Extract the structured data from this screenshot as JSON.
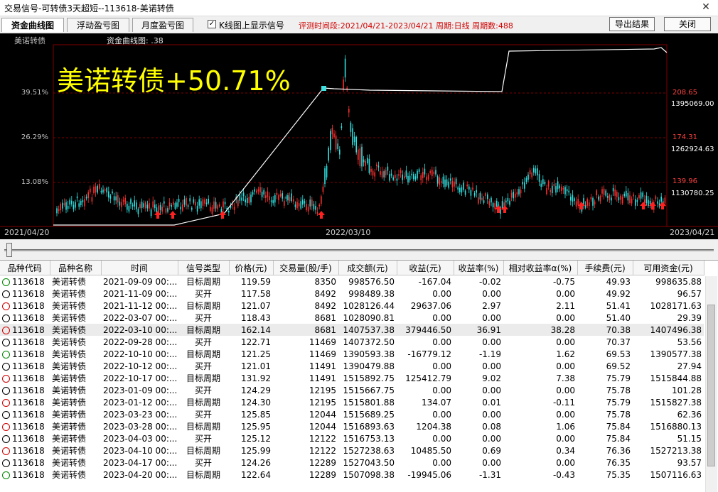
{
  "window": {
    "title": "交易信号-可转债3天超短--113618-美诺转债"
  },
  "toolbar": {
    "tabs": [
      {
        "label": "资金曲线图"
      },
      {
        "label": "浮动盈亏图"
      },
      {
        "label": "月度盈亏图"
      }
    ],
    "checkbox_label": "K线图上显示信号",
    "checkbox_checked": true,
    "period_text": "评测时间段:2021/04/21-2023/04/21  周期:日线  周期数:488",
    "export_label": "导出结果",
    "close_label": "关闭"
  },
  "chart": {
    "name": "美诺转债",
    "sub_label": "资金曲线图: ",
    "sub_value": ".38",
    "big_label": "美诺转债+50.71%",
    "left_axis": [
      "39.51%",
      "26.29%",
      "13.08%"
    ],
    "right_axis_price": [
      "208.65",
      "174.31",
      "139.96"
    ],
    "right_axis_capital": [
      "1395069.00",
      "1262924.63",
      "1130780.25"
    ],
    "dates": {
      "start": "2021/04/20",
      "mid": "2022/03/10",
      "end": "2023/04/21"
    },
    "colors": {
      "up": "#ff3030",
      "down": "#30e0e0",
      "equity": "#ffffff",
      "signal": "#ff2020",
      "grid": "#800000"
    }
  },
  "table": {
    "columns": [
      "品种代码",
      "品种名称",
      "时间",
      "信号类型",
      "价格(元)",
      "交易量(股/手)",
      "成交额(元)",
      "收益(元)",
      "收益率(%)",
      "相对收益率α(%)",
      "手续费(元)",
      "可用资金(元)"
    ],
    "rows": [
      {
        "icon": "green",
        "code": "113618",
        "name": "美诺转债",
        "time": "2021-09-09 00:...",
        "type": "目标周期",
        "price": "119.59",
        "volume": "8350",
        "amount": "998576.50",
        "profit": "-167.04",
        "rate": "-0.02",
        "alpha": "-0.75",
        "fee": "49.93",
        "cash": "998635.88"
      },
      {
        "icon": "black",
        "code": "113618",
        "name": "美诺转债",
        "time": "2021-11-09 00:...",
        "type": "买开",
        "price": "117.58",
        "volume": "8492",
        "amount": "998489.38",
        "profit": "0.00",
        "rate": "0.00",
        "alpha": "0.00",
        "fee": "49.92",
        "cash": "96.57"
      },
      {
        "icon": "red",
        "code": "113618",
        "name": "美诺转债",
        "time": "2021-11-12 00:...",
        "type": "目标周期",
        "price": "121.07",
        "volume": "8492",
        "amount": "1028126.44",
        "profit": "29637.06",
        "rate": "2.97",
        "alpha": "2.11",
        "fee": "51.41",
        "cash": "1028171.63"
      },
      {
        "icon": "black",
        "code": "113618",
        "name": "美诺转债",
        "time": "2022-03-07 00:...",
        "type": "买开",
        "price": "118.43",
        "volume": "8681",
        "amount": "1028090.81",
        "profit": "0.00",
        "rate": "0.00",
        "alpha": "0.00",
        "fee": "51.40",
        "cash": "29.39"
      },
      {
        "icon": "red",
        "code": "113618",
        "name": "美诺转债",
        "time": "2022-03-10 00:...",
        "type": "目标周期",
        "price": "162.14",
        "volume": "8681",
        "amount": "1407537.38",
        "profit": "379446.50",
        "rate": "36.91",
        "alpha": "38.28",
        "fee": "70.38",
        "cash": "1407496.38",
        "selected": true
      },
      {
        "icon": "black",
        "code": "113618",
        "name": "美诺转债",
        "time": "2022-09-28 00:...",
        "type": "买开",
        "price": "122.71",
        "volume": "11469",
        "amount": "1407372.50",
        "profit": "0.00",
        "rate": "0.00",
        "alpha": "0.00",
        "fee": "70.37",
        "cash": "53.56"
      },
      {
        "icon": "green",
        "code": "113618",
        "name": "美诺转债",
        "time": "2022-10-10 00:...",
        "type": "目标周期",
        "price": "121.25",
        "volume": "11469",
        "amount": "1390593.38",
        "profit": "-16779.12",
        "rate": "-1.19",
        "alpha": "1.62",
        "fee": "69.53",
        "cash": "1390577.38"
      },
      {
        "icon": "black",
        "code": "113618",
        "name": "美诺转债",
        "time": "2022-10-12 00:...",
        "type": "买开",
        "price": "121.01",
        "volume": "11491",
        "amount": "1390479.88",
        "profit": "0.00",
        "rate": "0.00",
        "alpha": "0.00",
        "fee": "69.52",
        "cash": "27.94"
      },
      {
        "icon": "red",
        "code": "113618",
        "name": "美诺转债",
        "time": "2022-10-17 00:...",
        "type": "目标周期",
        "price": "131.92",
        "volume": "11491",
        "amount": "1515892.75",
        "profit": "125412.79",
        "rate": "9.02",
        "alpha": "7.38",
        "fee": "75.79",
        "cash": "1515844.88"
      },
      {
        "icon": "black",
        "code": "113618",
        "name": "美诺转债",
        "time": "2023-01-09 00:...",
        "type": "买开",
        "price": "124.29",
        "volume": "12195",
        "amount": "1515667.75",
        "profit": "0.00",
        "rate": "0.00",
        "alpha": "0.00",
        "fee": "75.78",
        "cash": "101.28"
      },
      {
        "icon": "red",
        "code": "113618",
        "name": "美诺转债",
        "time": "2023-01-12 00:...",
        "type": "目标周期",
        "price": "124.30",
        "volume": "12195",
        "amount": "1515801.88",
        "profit": "134.07",
        "rate": "0.01",
        "alpha": "-0.11",
        "fee": "75.79",
        "cash": "1515827.38"
      },
      {
        "icon": "black",
        "code": "113618",
        "name": "美诺转债",
        "time": "2023-03-23 00:...",
        "type": "买开",
        "price": "125.85",
        "volume": "12044",
        "amount": "1515689.25",
        "profit": "0.00",
        "rate": "0.00",
        "alpha": "0.00",
        "fee": "75.78",
        "cash": "62.36"
      },
      {
        "icon": "red",
        "code": "113618",
        "name": "美诺转债",
        "time": "2023-03-28 00:...",
        "type": "目标周期",
        "price": "125.95",
        "volume": "12044",
        "amount": "1516893.63",
        "profit": "1204.38",
        "rate": "0.08",
        "alpha": "1.06",
        "fee": "75.84",
        "cash": "1516880.13"
      },
      {
        "icon": "black",
        "code": "113618",
        "name": "美诺转债",
        "time": "2023-04-03 00:...",
        "type": "买开",
        "price": "125.12",
        "volume": "12122",
        "amount": "1516753.13",
        "profit": "0.00",
        "rate": "0.00",
        "alpha": "0.00",
        "fee": "75.84",
        "cash": "51.15"
      },
      {
        "icon": "red",
        "code": "113618",
        "name": "美诺转债",
        "time": "2023-04-10 00:...",
        "type": "目标周期",
        "price": "125.99",
        "volume": "12122",
        "amount": "1527238.63",
        "profit": "10485.50",
        "rate": "0.69",
        "alpha": "0.34",
        "fee": "76.36",
        "cash": "1527213.38"
      },
      {
        "icon": "black",
        "code": "113618",
        "name": "美诺转债",
        "time": "2023-04-17 00:...",
        "type": "买开",
        "price": "124.26",
        "volume": "12289",
        "amount": "1527043.50",
        "profit": "0.00",
        "rate": "0.00",
        "alpha": "0.00",
        "fee": "76.35",
        "cash": "93.57"
      },
      {
        "icon": "green",
        "code": "113618",
        "name": "美诺转债",
        "time": "2023-04-20 00:...",
        "type": "目标周期",
        "price": "122.64",
        "volume": "12289",
        "amount": "1507098.38",
        "profit": "-19945.06",
        "rate": "-1.31",
        "alpha": "-0.43",
        "fee": "75.35",
        "cash": "1507116.63"
      }
    ]
  }
}
